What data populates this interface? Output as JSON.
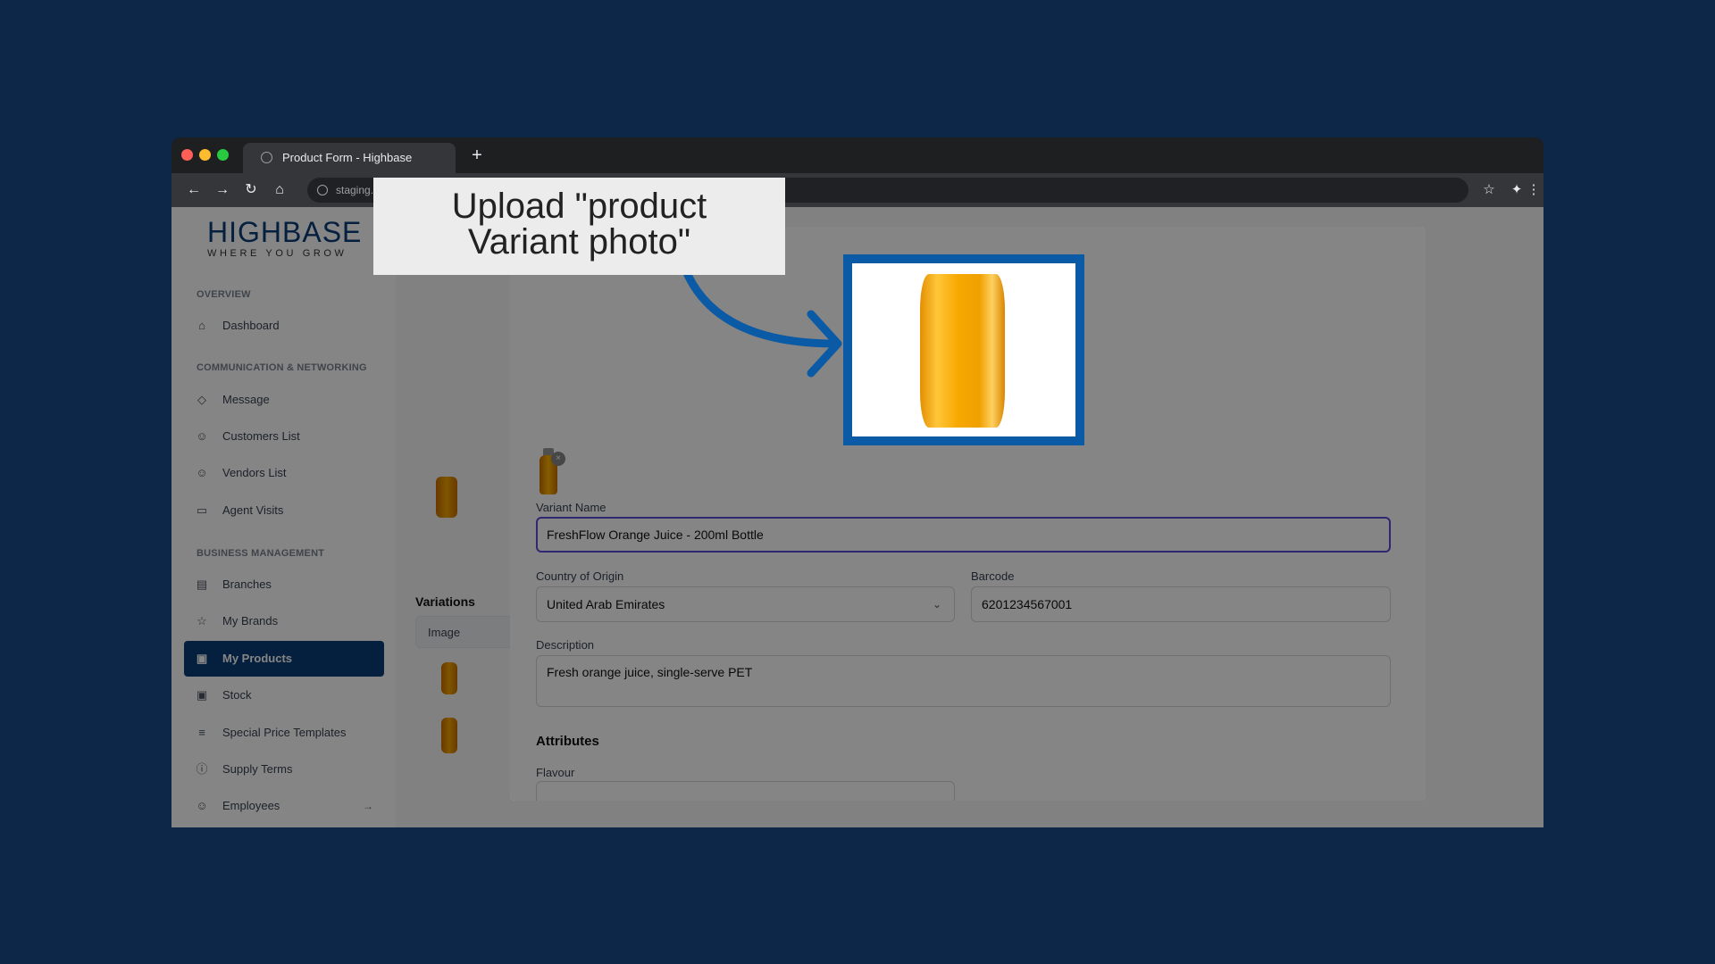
{
  "browser": {
    "tab_title": "Product Form - Highbase",
    "new_tab": "+",
    "url": "staging.highbase",
    "nav": {
      "back": "←",
      "forward": "→",
      "reload": "↻",
      "home": "⌂"
    },
    "icons": {
      "star": "☆",
      "extensions": "✦",
      "menu": "⋮"
    }
  },
  "sidebar": {
    "brand": "HIGHBASE",
    "tagline": "WHERE YOU GROW",
    "sections": {
      "overview": "OVERVIEW",
      "communication": "COMMUNICATION & NETWORKING",
      "business": "BUSINESS MANAGEMENT"
    },
    "items": [
      {
        "label": "Dashboard",
        "icon": "home-icon",
        "glyph": "⌂"
      },
      {
        "label": "Message",
        "icon": "message-icon",
        "glyph": "◇"
      },
      {
        "label": "Customers List",
        "icon": "users-icon",
        "glyph": "☺"
      },
      {
        "label": "Vendors List",
        "icon": "users-icon",
        "glyph": "☺"
      },
      {
        "label": "Agent Visits",
        "icon": "truck-icon",
        "glyph": "▭"
      },
      {
        "label": "Branches",
        "icon": "store-icon",
        "glyph": "▤"
      },
      {
        "label": "My Brands",
        "icon": "star-icon",
        "glyph": "☆"
      },
      {
        "label": "My Products",
        "icon": "box-icon",
        "glyph": "▣",
        "active": true
      },
      {
        "label": "Stock",
        "icon": "box-icon",
        "glyph": "▣"
      },
      {
        "label": "Special Price Templates",
        "icon": "list-icon",
        "glyph": "≡"
      },
      {
        "label": "Supply Terms",
        "icon": "info-icon",
        "glyph": "ⓘ"
      },
      {
        "label": "Employees",
        "icon": "users-icon",
        "glyph": "☺",
        "arrow": "→"
      }
    ]
  },
  "background": {
    "variations_title": "Variations",
    "image_col": "Image"
  },
  "modal": {
    "variant_name_label": "Variant Name",
    "variant_name_value": "FreshFlow Orange Juice - 200ml Bottle",
    "country_label": "Country of Origin",
    "country_value": "United Arab Emirates",
    "barcode_label": "Barcode",
    "barcode_value": "6201234567001",
    "description_label": "Description",
    "description_value": "Fresh orange juice, single-serve PET",
    "attributes_title": "Attributes",
    "flavour_label": "Flavour",
    "remove_icon": "×",
    "chevron": "⌄"
  },
  "callout": {
    "text_line1": "Upload \"product",
    "text_line2": "Variant photo\""
  },
  "colors": {
    "backdrop": "#0c2748",
    "brand": "#0b3d78",
    "focus": "#5b4bdb",
    "frame": "#0b5aa6"
  }
}
